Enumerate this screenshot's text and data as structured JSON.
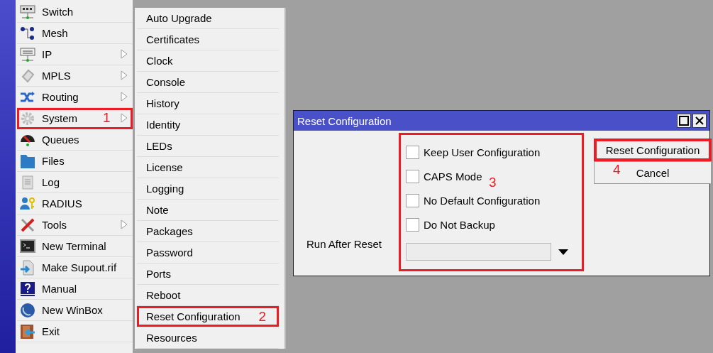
{
  "main_menu": {
    "items": [
      {
        "label": "Switch",
        "has_submenu": false,
        "highlighted": false
      },
      {
        "label": "Mesh",
        "has_submenu": false,
        "highlighted": false
      },
      {
        "label": "IP",
        "has_submenu": true,
        "highlighted": false
      },
      {
        "label": "MPLS",
        "has_submenu": true,
        "highlighted": false
      },
      {
        "label": "Routing",
        "has_submenu": true,
        "highlighted": false
      },
      {
        "label": "System",
        "has_submenu": true,
        "highlighted": true,
        "callout": "1"
      },
      {
        "label": "Queues",
        "has_submenu": false,
        "highlighted": false
      },
      {
        "label": "Files",
        "has_submenu": false,
        "highlighted": false
      },
      {
        "label": "Log",
        "has_submenu": false,
        "highlighted": false
      },
      {
        "label": "RADIUS",
        "has_submenu": false,
        "highlighted": false
      },
      {
        "label": "Tools",
        "has_submenu": true,
        "highlighted": false
      },
      {
        "label": "New Terminal",
        "has_submenu": false,
        "highlighted": false
      },
      {
        "label": "Make Supout.rif",
        "has_submenu": false,
        "highlighted": false
      },
      {
        "label": "Manual",
        "has_submenu": false,
        "highlighted": false
      },
      {
        "label": "New WinBox",
        "has_submenu": false,
        "highlighted": false
      },
      {
        "label": "Exit",
        "has_submenu": false,
        "highlighted": false
      }
    ]
  },
  "submenu": {
    "items": [
      {
        "label": "Auto Upgrade",
        "highlighted": false
      },
      {
        "label": "Certificates",
        "highlighted": false
      },
      {
        "label": "Clock",
        "highlighted": false
      },
      {
        "label": "Console",
        "highlighted": false
      },
      {
        "label": "History",
        "highlighted": false
      },
      {
        "label": "Identity",
        "highlighted": false
      },
      {
        "label": "LEDs",
        "highlighted": false
      },
      {
        "label": "License",
        "highlighted": false
      },
      {
        "label": "Logging",
        "highlighted": false
      },
      {
        "label": "Note",
        "highlighted": false
      },
      {
        "label": "Packages",
        "highlighted": false
      },
      {
        "label": "Password",
        "highlighted": false
      },
      {
        "label": "Ports",
        "highlighted": false
      },
      {
        "label": "Reboot",
        "highlighted": false
      },
      {
        "label": "Reset Configuration",
        "highlighted": true,
        "callout": "2"
      },
      {
        "label": "Resources",
        "highlighted": false
      }
    ]
  },
  "dialog": {
    "title": "Reset Configuration",
    "options": {
      "highlighted": true,
      "callout": "3",
      "checkboxes": [
        {
          "label": "Keep User Configuration",
          "checked": false
        },
        {
          "label": "CAPS Mode",
          "checked": false
        },
        {
          "label": "No Default Configuration",
          "checked": false
        },
        {
          "label": "Do Not Backup",
          "checked": false
        }
      ],
      "run_after_reset": {
        "label": "Run After Reset"
      }
    },
    "buttons": [
      {
        "label": "Reset Configuration",
        "highlighted": true,
        "callout": "4"
      },
      {
        "label": "Cancel",
        "highlighted": false
      }
    ]
  }
}
